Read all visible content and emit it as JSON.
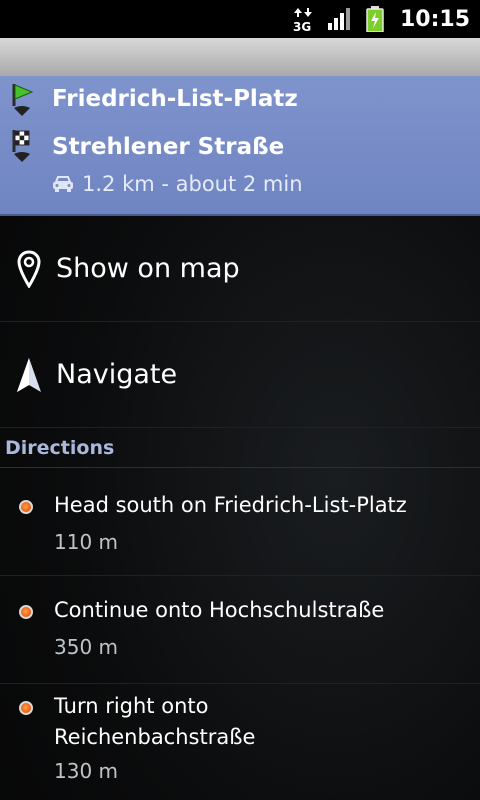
{
  "status_bar": {
    "network": "3G",
    "time": "10:15"
  },
  "route": {
    "from": "Friedrich-List-Platz",
    "to": "Strehlener Straße",
    "summary": "1.2 km - about 2 min"
  },
  "actions": {
    "show_on_map": "Show on map",
    "navigate": "Navigate"
  },
  "directions": {
    "header": "Directions",
    "steps": [
      {
        "instruction": "Head south on Friedrich-List-Platz",
        "distance": "110 m"
      },
      {
        "instruction": "Continue onto Hochschulstraße",
        "distance": "350 m"
      },
      {
        "instruction": "Turn right onto Reichenbachstraße",
        "distance": "130 m"
      }
    ]
  },
  "colors": {
    "route_header": "#7489c6",
    "step_dot": "#ef6a18",
    "directions_header": "#a9b9dc",
    "battery_green": "#7ccf2a"
  }
}
